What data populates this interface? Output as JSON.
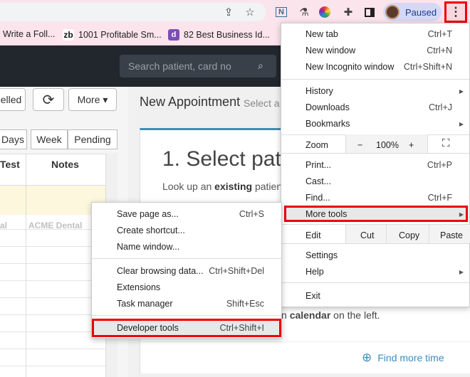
{
  "browser": {
    "paused_label": "Paused",
    "bookmarks": [
      {
        "label": "Write a Foll...",
        "icon": "bookmark-page-icon"
      },
      {
        "label": "1001 Profitable Sm...",
        "icon": "zoho-logo-icon"
      },
      {
        "label": "82 Best Business Id...",
        "icon": "d-logo-icon"
      }
    ]
  },
  "app": {
    "search_placeholder": "Search patient, card no",
    "cancelled_label": "elled",
    "more_button": "More ▾",
    "view_tabs": [
      "Days",
      "Week",
      "Pending"
    ],
    "grid_headers": [
      "Test",
      "Notes"
    ],
    "grid_row_values": [
      "al",
      "ACME Dental"
    ]
  },
  "appointment": {
    "title": "New Appointment",
    "subtitle": "Select a",
    "step_title": "1. Select pat",
    "lookup_pre": "Look up an ",
    "lookup_bold": "existing",
    "lookup_post": " patien",
    "calendar_pre": "n ",
    "calendar_bold": "calendar",
    "calendar_post": " on the left.",
    "find_more": "Find more time"
  },
  "chrome_menu": {
    "new_tab": {
      "label": "New tab",
      "shortcut": "Ctrl+T"
    },
    "new_window": {
      "label": "New window",
      "shortcut": "Ctrl+N"
    },
    "incognito": {
      "label": "New Incognito window",
      "shortcut": "Ctrl+Shift+N"
    },
    "history": {
      "label": "History"
    },
    "downloads": {
      "label": "Downloads",
      "shortcut": "Ctrl+J"
    },
    "bookmarks": {
      "label": "Bookmarks"
    },
    "zoom": {
      "label": "Zoom",
      "minus": "−",
      "value": "100%",
      "plus": "+"
    },
    "print": {
      "label": "Print...",
      "shortcut": "Ctrl+P"
    },
    "cast": {
      "label": "Cast..."
    },
    "find": {
      "label": "Find...",
      "shortcut": "Ctrl+F"
    },
    "more_tools": {
      "label": "More tools"
    },
    "edit": {
      "label": "Edit",
      "cut": "Cut",
      "copy": "Copy",
      "paste": "Paste"
    },
    "settings": {
      "label": "Settings"
    },
    "help": {
      "label": "Help"
    },
    "exit": {
      "label": "Exit"
    }
  },
  "more_tools_menu": {
    "save_page": {
      "label": "Save page as...",
      "shortcut": "Ctrl+S"
    },
    "create_shortcut": {
      "label": "Create shortcut..."
    },
    "name_window": {
      "label": "Name window..."
    },
    "clear_data": {
      "label": "Clear browsing data...",
      "shortcut": "Ctrl+Shift+Del"
    },
    "extensions": {
      "label": "Extensions"
    },
    "task_manager": {
      "label": "Task manager",
      "shortcut": "Shift+Esc"
    },
    "dev_tools": {
      "label": "Developer tools",
      "shortcut": "Ctrl+Shift+I"
    }
  },
  "colors": {
    "highlight": "#ee0000",
    "accent": "#3c8dbc",
    "header": "#22272e"
  }
}
